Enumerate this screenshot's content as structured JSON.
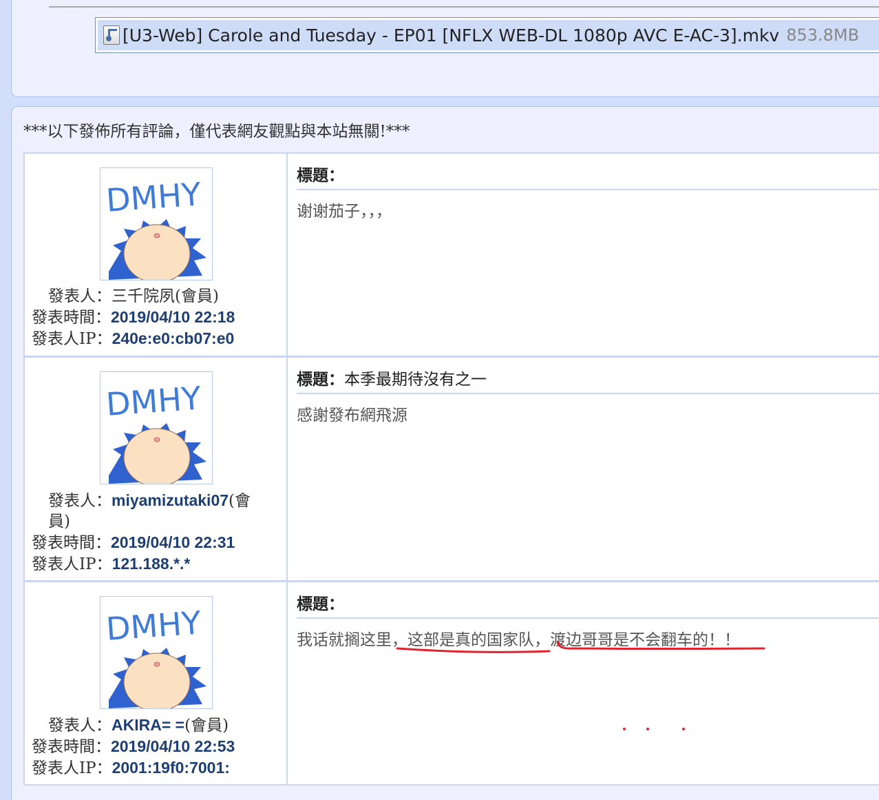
{
  "file": {
    "name": "[U3-Web] Carole and Tuesday - EP01 [NFLX WEB-DL 1080p AVC E-AC-3].mkv",
    "size": "853.8MB",
    "icon": "video-file-icon"
  },
  "comments_header": "***以下發佈所有評論，僅代表網友觀點與本站無關!***",
  "labels": {
    "author": "發表人：",
    "time": "發表時間：",
    "ip": "發表人IP：",
    "title": "標題："
  },
  "avatar": {
    "text": "DMHY",
    "colors": {
      "text": "#3f7bd9",
      "hair": "#2f62cf",
      "face": "#fbe0c2"
    }
  },
  "comments": [
    {
      "author": "三千院夙",
      "role": "(會員)",
      "time": "2019/04/10 22:18",
      "ip": "240e:e0:cb07:e0",
      "title": "",
      "body": "谢谢茄子，，，"
    },
    {
      "author": "miyamizutaki07",
      "role": "(會員)",
      "time": "2019/04/10 22:31",
      "ip": "121.188.*.*",
      "title": "本季最期待沒有之一",
      "body": "感謝發布網飛源"
    },
    {
      "author": "AKIRA= =",
      "role": "(會員)",
      "time": "2019/04/10 22:53",
      "ip": "2001:19f0:7001:",
      "title": "",
      "body_parts": [
        "我话就搁这里，",
        "这部是真的国家队",
        "，",
        "渡边哥哥是不会翻车的！！"
      ]
    }
  ],
  "annotation_color": "#e0242f"
}
